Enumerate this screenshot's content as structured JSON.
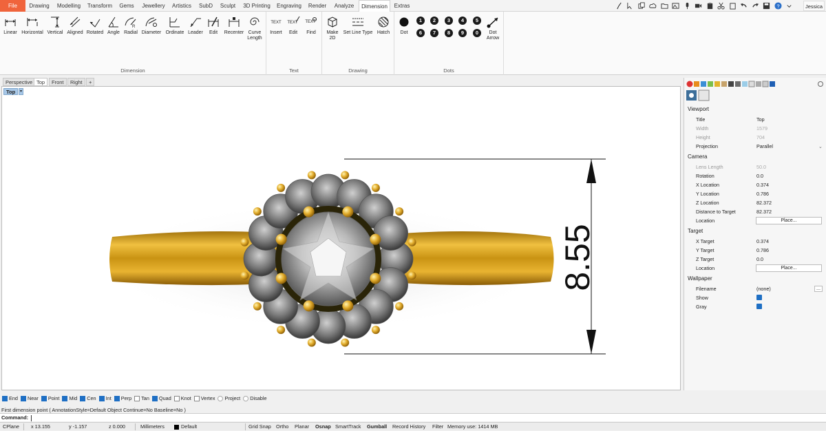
{
  "menu": {
    "tabs": [
      "File",
      "Drawing",
      "Modelling",
      "Transform",
      "Gems",
      "Jewellery",
      "Artistics",
      "SubD",
      "Sculpt",
      "3D Printing",
      "Engraving",
      "Render",
      "Analyze",
      "Dimension",
      "Extras"
    ],
    "active_tab": "Dimension",
    "user": "Jessica"
  },
  "quick_access_icons": [
    "brush-icon",
    "select-icon",
    "copy-icon",
    "cloud-icon",
    "folder-icon",
    "image-icon",
    "mic-icon",
    "video-icon",
    "paste-icon",
    "cut-icon",
    "clipboard-icon",
    "undo-icon",
    "redo-icon",
    "save-icon",
    "help-icon",
    "options-icon"
  ],
  "ribbon": {
    "groups": [
      {
        "label": "Dimension",
        "buttons": [
          "Linear",
          "Horizontal",
          "Vertical",
          "Aligned",
          "Rotated",
          "Angle",
          "Radial",
          "Diameter",
          "Ordinate",
          "Leader",
          "Edit",
          "Recenter",
          "Curve\nLength"
        ]
      },
      {
        "label": "Text",
        "buttons": [
          "Insert",
          "Edit",
          "Find"
        ]
      },
      {
        "label": "Drawing",
        "buttons": [
          "Make\n2D",
          "Set Line Type",
          "Hatch"
        ]
      },
      {
        "label": "Dots",
        "buttons": [
          "Dot",
          "Dot\nArrow"
        ]
      }
    ],
    "dot_numbers": [
      "1",
      "2",
      "3",
      "4",
      "5",
      "6",
      "7",
      "8",
      "9",
      "0"
    ]
  },
  "viewport_tabs": [
    "Perspective",
    "Top",
    "Front",
    "Right",
    "+"
  ],
  "active_viewport_tab": "Top",
  "viewport": {
    "label": "Top",
    "dimension_value": "8.55"
  },
  "properties": {
    "sections": {
      "viewport": "Viewport",
      "camera": "Camera",
      "target": "Target",
      "wallpaper": "Wallpaper"
    },
    "viewport_rows": [
      {
        "key": "Title",
        "value": "Top"
      },
      {
        "key": "Width",
        "value": "1579"
      },
      {
        "key": "Height",
        "value": "704"
      },
      {
        "key": "Projection",
        "value": "Parallel"
      }
    ],
    "camera_rows": [
      {
        "key": "Lens Length",
        "value": "50.0"
      },
      {
        "key": "Rotation",
        "value": "0.0"
      },
      {
        "key": "X Location",
        "value": "0.374"
      },
      {
        "key": "Y Location",
        "value": "0.786"
      },
      {
        "key": "Z Location",
        "value": "82.372"
      },
      {
        "key": "Distance to Target",
        "value": "82.372"
      },
      {
        "key": "Location",
        "value": "Place..."
      }
    ],
    "target_rows": [
      {
        "key": "X Target",
        "value": "0.374"
      },
      {
        "key": "Y Target",
        "value": "0.786"
      },
      {
        "key": "Z Target",
        "value": "0.0"
      },
      {
        "key": "Location",
        "value": "Place..."
      }
    ],
    "wallpaper_rows": [
      {
        "key": "Filename",
        "value": "(none)"
      },
      {
        "key": "Show",
        "value": "checked"
      },
      {
        "key": "Gray",
        "value": "checked"
      }
    ],
    "browse_label": "..."
  },
  "osnap": [
    {
      "label": "End",
      "checked": true
    },
    {
      "label": "Near",
      "checked": true
    },
    {
      "label": "Point",
      "checked": true
    },
    {
      "label": "Mid",
      "checked": true
    },
    {
      "label": "Cen",
      "checked": true
    },
    {
      "label": "Int",
      "checked": true
    },
    {
      "label": "Perp",
      "checked": true
    },
    {
      "label": "Tan",
      "checked": false
    },
    {
      "label": "Quad",
      "checked": true
    },
    {
      "label": "Knot",
      "checked": false
    },
    {
      "label": "Vertex",
      "checked": false
    },
    {
      "label": "Project",
      "radio": true
    },
    {
      "label": "Disable",
      "radio": true
    }
  ],
  "command": {
    "history": "First dimension point ( AnnotationStyle=Default  Object  Continue=No  Baseline=No )",
    "prompt": "Command:"
  },
  "status": {
    "cplane": "CPlane",
    "x": "x 13.155",
    "y": "y -1.157",
    "z": "z 0.000",
    "units": "Millimeters",
    "layer": "Default",
    "toggles": [
      "Grid Snap",
      "Ortho",
      "Planar",
      "Osnap",
      "SmartTrack",
      "Gumball",
      "Record History",
      "Filter"
    ],
    "memory": "Memory use: 1414 MB"
  }
}
